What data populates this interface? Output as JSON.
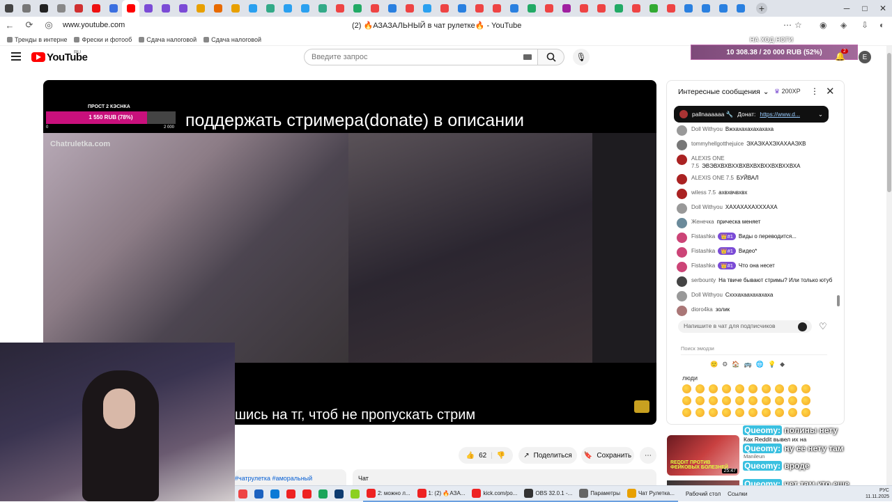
{
  "browser": {
    "tab_colors": [
      "#444",
      "#777",
      "#222",
      "#888",
      "#d03030",
      "#e11",
      "#3b6fe0",
      "#f00",
      "#7b4bd6",
      "#7b4bd6",
      "#7b4bd6",
      "#e8a000",
      "#e86a00",
      "#e8a000",
      "#2aa0f0",
      "#3a8",
      "#2aa0f0",
      "#2aa0f0",
      "#3a8",
      "#e44",
      "#2a6",
      "#e44",
      "#2a80e0",
      "#e44",
      "#2aa0f0",
      "#e44",
      "#2a80e0",
      "#e44",
      "#e44",
      "#2a80e0",
      "#2a6",
      "#e44",
      "#a020a0",
      "#e44",
      "#e44",
      "#2a6",
      "#e44",
      "#3a3",
      "#e44",
      "#2a80e0",
      "#2a80e0",
      "#2a80e0",
      "#2a80e0"
    ],
    "url": "www.youtube.com",
    "page_title": "(2) 🔥АЗАЗАЛЬНЫЙ в чат рулетке🔥 - YouTube",
    "bookmarks": [
      "Тренды в интерне",
      "Фрески и фотооб",
      "Сдача налоговой",
      "Сдача налоговой"
    ]
  },
  "youtube": {
    "logo_text": "YouTube",
    "region": "RU",
    "search_placeholder": "Введите запрос",
    "avatar_letter": "E",
    "notif_count": "2",
    "overlay_top_label": "НА ХОД НОГИ",
    "sub_goal": "10 308.38 / 20 000 RUB (52%)",
    "sub_goal_fraction": 0.52
  },
  "video": {
    "goal_title": "ПРОСТ 2 КЭСНКА",
    "goal_text": "1 550 RUB (78%)",
    "goal_fraction": 0.78,
    "goal_min": "0",
    "goal_max": "2 000",
    "top_caption": "поддержать стримера(donate) в описании",
    "watermark": "Chatruletka.com",
    "bottom_caption": "шись на тг, чтоб не пропускать стрим"
  },
  "actions": {
    "likes": "62",
    "share": "Поделиться",
    "save": "Сохранить",
    "tags": "#чатрулетка #аморальный",
    "chat_tab": "Чат"
  },
  "chat": {
    "header": "Интересные сообщения",
    "xp": "200XP",
    "pinned_user": "pallnaaaaaa 🔧",
    "pinned_text": "Донат:",
    "pinned_link": "https://www.d...",
    "messages": [
      {
        "author": "Doll Withyou",
        "text": "Вжхахахахахахаха",
        "badge": "",
        "color": "#999"
      },
      {
        "author": "tommyhellgotthejuice",
        "text": "ЭХАЭХАХЭХАХААЭХВ",
        "badge": "",
        "color": "#777"
      },
      {
        "author": "ALEXIS ONE 7.5",
        "text": "ЭВЭВХВХВХХВХВХВХВХХВХВХХВХА",
        "badge": "",
        "color": "#a22"
      },
      {
        "author": "ALEXIS ONE 7.5",
        "text": "БУЙВАЛ",
        "badge": "",
        "color": "#a22"
      },
      {
        "author": "wiless 7.5",
        "text": "ахвхвчвхвх",
        "badge": "",
        "color": "#a22"
      },
      {
        "author": "Doll Withyou",
        "text": "ХАХАХАХАХХХАХА",
        "badge": "",
        "color": "#999"
      },
      {
        "author": "Женечка",
        "text": "прическа меняет",
        "badge": "",
        "color": "#6a8a9a"
      },
      {
        "author": "Fistashka",
        "text": "Виды о переводится...",
        "badge": "👑#1",
        "color": "#c47"
      },
      {
        "author": "Fistashka",
        "text": "Видео*",
        "badge": "👑#1",
        "color": "#c47"
      },
      {
        "author": "Fistashka",
        "text": "Что она несет",
        "badge": "👑#1",
        "color": "#c47"
      },
      {
        "author": "serbounty",
        "text": "На твиче бывают стримы? Или только ютуб",
        "badge": "",
        "color": "#444"
      },
      {
        "author": "Doll Withyou",
        "text": "Схххахаахахахаха",
        "badge": "",
        "color": "#999"
      },
      {
        "author": "dioro4ka",
        "text": "золик",
        "badge": "",
        "color": "#a77"
      }
    ],
    "input_placeholder": "Напишите в чат для подписчиков",
    "emoji_search_placeholder": "Поиск эмодзи",
    "emoji_section": "люди",
    "emoji_category_icons": [
      "🙂",
      "⚙",
      "🏠",
      "🚌",
      "🌐",
      "💡",
      "◆"
    ]
  },
  "recommended": {
    "title": "Как Reddit вывел их на",
    "channel": "Manileun",
    "thumb_text": "REDDIT ПРОТИВ ФЕЙКОВЫХ БОЛЕЗНЕЙ",
    "duration": "25:47"
  },
  "overlay_chat": [
    {
      "name": "Queomy:",
      "text": "полины нету"
    },
    {
      "name": "Queomy:",
      "text": "ну ее нету там"
    },
    {
      "name": "Queomy:",
      "text": "вроде"
    },
    {
      "name": "Queomy:",
      "text": "чет там кто еще"
    }
  ],
  "taskbar": {
    "items": [
      {
        "label": "",
        "color": "#e44"
      },
      {
        "label": "",
        "color": "#1c62c0"
      },
      {
        "label": "",
        "color": "#0a7ad6"
      },
      {
        "label": "",
        "color": "#e22"
      },
      {
        "label": "",
        "color": "#e22"
      },
      {
        "label": "",
        "color": "#1aa55a"
      },
      {
        "label": "",
        "color": "#0d3b70"
      },
      {
        "label": "",
        "color": "#8bd020"
      },
      {
        "label": "2: можно л...",
        "color": "#e22"
      },
      {
        "label": "1: (2) 🔥АЗА...",
        "color": "#e22"
      },
      {
        "label": "kick.com/po...",
        "color": "#e22"
      },
      {
        "label": "OBS 32.0.1 -...",
        "color": "#333"
      },
      {
        "label": "Параметры",
        "color": "#666"
      },
      {
        "label": "Чат Рулетка...",
        "color": "#e8a000"
      }
    ],
    "desktop_label": "Рабочий стол",
    "links_label": "Ссылки",
    "lang": "РУС",
    "date": "11.11.2025"
  }
}
